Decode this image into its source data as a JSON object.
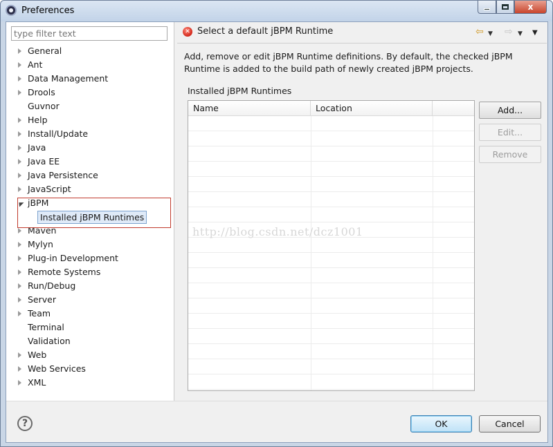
{
  "window": {
    "title": "Preferences",
    "minimize": "",
    "maximize": "",
    "close": "x"
  },
  "sidebar": {
    "filter_placeholder": "type filter text",
    "items": [
      {
        "label": "General",
        "expandable": true
      },
      {
        "label": "Ant",
        "expandable": true
      },
      {
        "label": "Data Management",
        "expandable": true
      },
      {
        "label": "Drools",
        "expandable": true
      },
      {
        "label": "Guvnor",
        "expandable": false
      },
      {
        "label": "Help",
        "expandable": true
      },
      {
        "label": "Install/Update",
        "expandable": true
      },
      {
        "label": "Java",
        "expandable": true
      },
      {
        "label": "Java EE",
        "expandable": true
      },
      {
        "label": "Java Persistence",
        "expandable": true
      },
      {
        "label": "JavaScript",
        "expandable": true
      },
      {
        "label": "jBPM",
        "expandable": true,
        "expanded": true
      },
      {
        "label": "Installed jBPM Runtimes",
        "child": true,
        "selected": true
      },
      {
        "label": "Maven",
        "expandable": true
      },
      {
        "label": "Mylyn",
        "expandable": true
      },
      {
        "label": "Plug-in Development",
        "expandable": true
      },
      {
        "label": "Remote Systems",
        "expandable": true
      },
      {
        "label": "Run/Debug",
        "expandable": true
      },
      {
        "label": "Server",
        "expandable": true
      },
      {
        "label": "Team",
        "expandable": true
      },
      {
        "label": "Terminal",
        "expandable": false
      },
      {
        "label": "Validation",
        "expandable": false
      },
      {
        "label": "Web",
        "expandable": true
      },
      {
        "label": "Web Services",
        "expandable": true
      },
      {
        "label": "XML",
        "expandable": true
      }
    ]
  },
  "page": {
    "error_icon": "error-icon",
    "title": "Select a default jBPM Runtime",
    "description": "Add, remove or edit jBPM Runtime definitions. By default, the checked jBPM Runtime is added to the build path of newly created jBPM projects.",
    "table_label": "Installed jBPM Runtimes",
    "columns": [
      "Name",
      "Location"
    ],
    "rows": [],
    "buttons": {
      "add": "Add...",
      "edit": "Edit...",
      "remove": "Remove"
    },
    "watermark": "http://blog.csdn.net/dcz1001"
  },
  "footer": {
    "help": "?",
    "ok": "OK",
    "cancel": "Cancel"
  },
  "colors": {
    "accent": "#3c7fb1",
    "highlight_border": "#c0392b",
    "error": "#d2261a"
  }
}
